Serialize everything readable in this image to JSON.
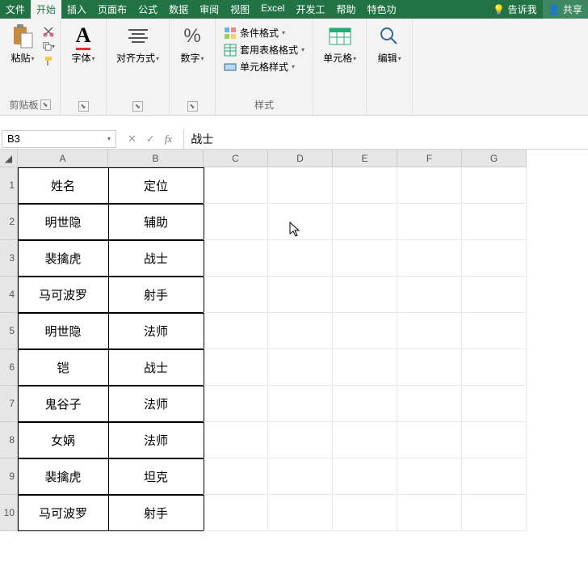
{
  "tabs": {
    "t0": "文件",
    "t1": "开始",
    "t2": "插入",
    "t3": "页面布",
    "t4": "公式",
    "t5": "数据",
    "t6": "审阅",
    "t7": "视图",
    "t8": "Excel",
    "t9": "开发工",
    "t10": "帮助",
    "t11": "特色功",
    "tellme": "告诉我",
    "share": "共享"
  },
  "ribbon": {
    "clipboard": "剪贴板",
    "paste": "粘贴",
    "font": "字体",
    "align": "对齐方式",
    "number": "数字",
    "styles": "样式",
    "cond": "条件格式",
    "tbl": "套用表格格式",
    "cellstyle": "单元格样式",
    "cells": "单元格",
    "edit": "编辑"
  },
  "namebox": "B3",
  "formula": "战士",
  "cols": [
    "A",
    "B",
    "C",
    "D",
    "E",
    "F",
    "G"
  ],
  "rows": [
    "1",
    "2",
    "3",
    "4",
    "5",
    "6",
    "7",
    "8",
    "9",
    "10"
  ],
  "data": {
    "r1": {
      "a": "姓名",
      "b": "定位"
    },
    "r2": {
      "a": "明世隐",
      "b": "辅助"
    },
    "r3": {
      "a": "裴擒虎",
      "b": "战士"
    },
    "r4": {
      "a": "马可波罗",
      "b": "射手"
    },
    "r5": {
      "a": "明世隐",
      "b": "法师"
    },
    "r6": {
      "a": "铠",
      "b": "战士"
    },
    "r7": {
      "a": "鬼谷子",
      "b": "法师"
    },
    "r8": {
      "a": "女娲",
      "b": "法师"
    },
    "r9": {
      "a": "裴擒虎",
      "b": "坦克"
    },
    "r10": {
      "a": "马可波罗",
      "b": "射手"
    }
  }
}
